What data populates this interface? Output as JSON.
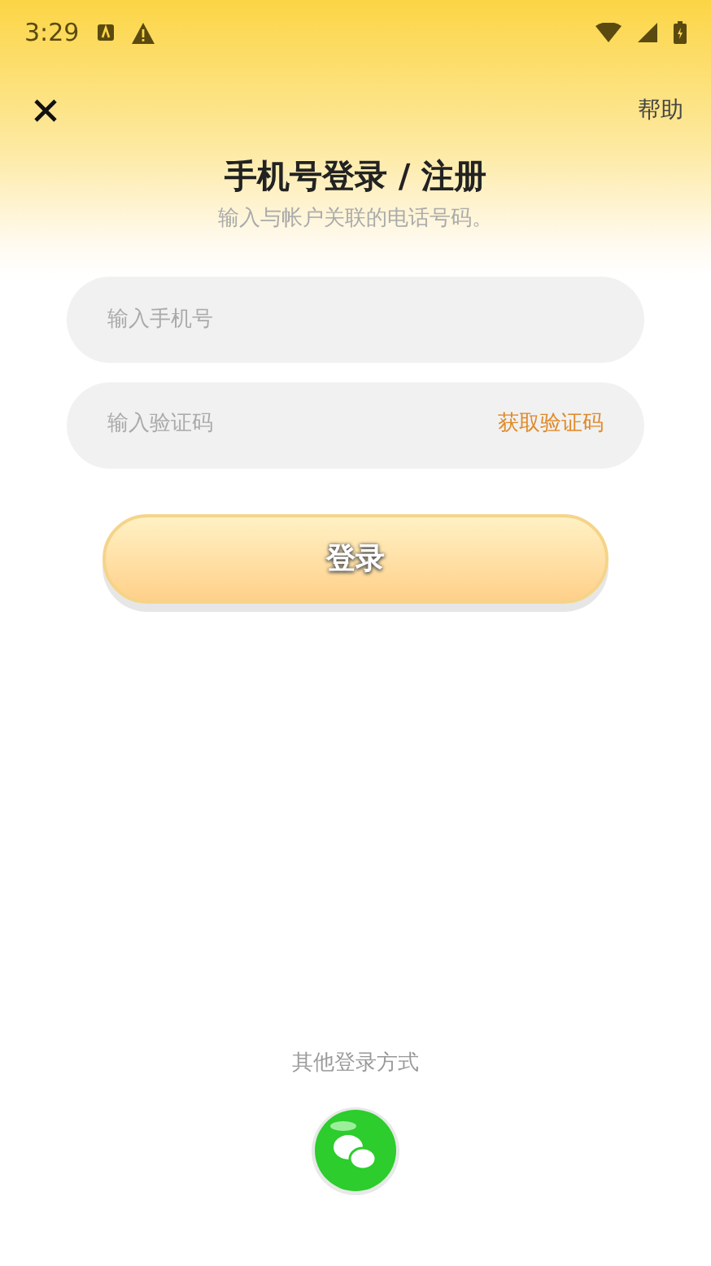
{
  "status_bar": {
    "time": "3:29"
  },
  "header": {
    "help": "帮助",
    "title": "手机号登录 / 注册",
    "subtitle": "输入与帐户关联的电话号码。"
  },
  "phone_field": {
    "placeholder": "输入手机号"
  },
  "code_field": {
    "placeholder": "输入验证码",
    "action": "获取验证码"
  },
  "login_button": "登录",
  "other_login": {
    "label": "其他登录方式"
  }
}
